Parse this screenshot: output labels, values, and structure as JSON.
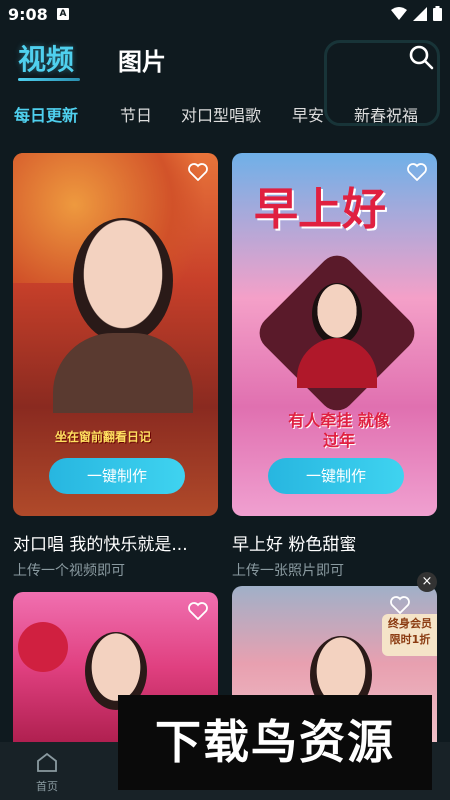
{
  "status": {
    "time": "9:08"
  },
  "header": {
    "tab_video": "视频",
    "tab_pictures": "图片"
  },
  "categories": [
    "每日更新",
    "节日",
    "对口型唱歌",
    "早安",
    "新春祝福"
  ],
  "cards": [
    {
      "overlay_text": "坐在窗前翻看日记",
      "button": "一键制作",
      "title": "对口唱 我的快乐就是...",
      "subtitle": "上传一个视频即可"
    },
    {
      "overlay_text": "早上好",
      "overlay_text2": "有人牵挂 就像过年",
      "button": "一键制作",
      "title": "早上好  粉色甜蜜",
      "subtitle": "上传一张照片即可"
    },
    {
      "badge": "终身会员 限时1折"
    },
    {}
  ],
  "nav": {
    "home": "首页"
  },
  "ad": {
    "text": "下载鸟资源",
    "close": "×"
  },
  "colors": {
    "accent": "#4fd0ee",
    "background": "#0f1a1f"
  }
}
